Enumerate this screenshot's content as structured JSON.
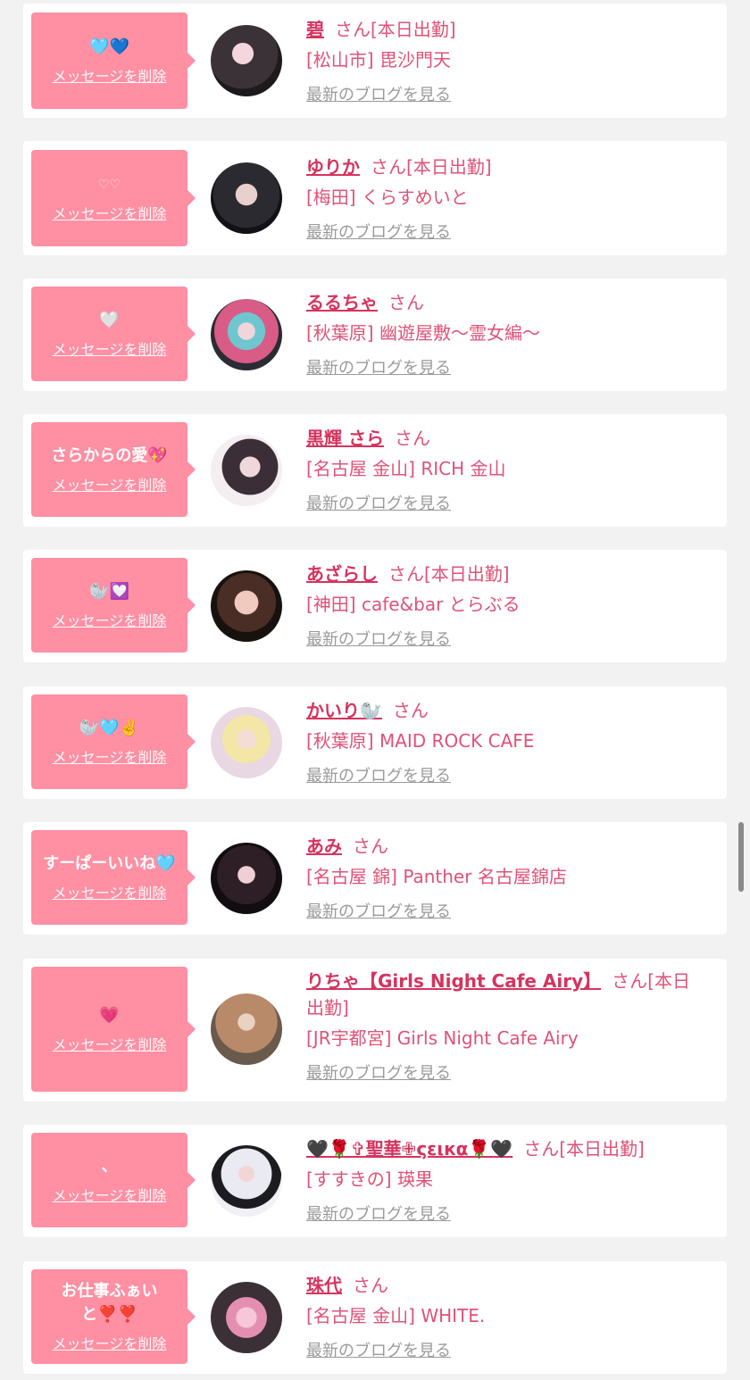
{
  "delete_label": "メッセージを削除",
  "blog_label": "最新のブログを見る",
  "san_label": "さん",
  "cards": [
    {
      "message": "🩵💙",
      "name": "碧",
      "status": "[本日出勤]",
      "shop": "[松山市] 毘沙門天"
    },
    {
      "message": "♡♡",
      "name": "ゆりか",
      "status": "[本日出勤]",
      "shop": "[梅田] くらすめいと"
    },
    {
      "message": "🤍",
      "name": "るるちゃ",
      "status": "",
      "shop": "[秋葉原] 幽遊屋敷〜霊女編〜"
    },
    {
      "message": "さらからの愛💖",
      "name": "黒輝 さら",
      "status": "",
      "shop": "[名古屋 金山] RICH 金山"
    },
    {
      "message": "🦭💟",
      "name": "あざらし",
      "status": "[本日出勤]",
      "shop": "[神田] cafe&bar とらぶる"
    },
    {
      "message": "🦭🩵✌️",
      "name": "かいり🦭",
      "status": "",
      "shop": "[秋葉原] MAID ROCK CAFE"
    },
    {
      "message": "すーぱーいいね🩵",
      "name": "あみ",
      "status": "",
      "shop": "[名古屋 錦] Panther 名古屋錦店"
    },
    {
      "message": "💗",
      "name": "りちゃ【Girls Night Cafe Airy】",
      "status": "[本日出勤]",
      "shop": "[JR宇都宮] Girls Night Cafe Airy"
    },
    {
      "message": "、",
      "name": "🖤🌹✞聖華✙ςειкα🌹🖤",
      "status": "[本日出勤]",
      "shop": "[すすきの] 瑛果"
    },
    {
      "message": "お仕事ふぁいと❣️❣️",
      "name": "珠代",
      "status": "",
      "shop": "[名古屋 金山] WHITE."
    }
  ]
}
